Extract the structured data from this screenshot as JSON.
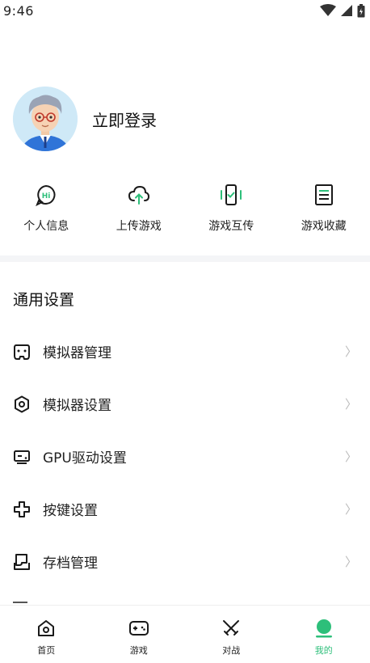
{
  "status_bar": {
    "time": "9:46"
  },
  "profile": {
    "login_label": "立即登录"
  },
  "quick_actions": [
    {
      "label": "个人信息",
      "icon": "chat-hi-icon"
    },
    {
      "label": "上传游戏",
      "icon": "cloud-upload-icon"
    },
    {
      "label": "游戏互传",
      "icon": "phone-transfer-icon"
    },
    {
      "label": "游戏收藏",
      "icon": "list-document-icon"
    }
  ],
  "general_settings": {
    "title": "通用设置",
    "items": [
      {
        "label": "模拟器管理",
        "icon": "gamepad-icon"
      },
      {
        "label": "模拟器设置",
        "icon": "gear-icon"
      },
      {
        "label": "GPU驱动设置",
        "icon": "gpu-icon"
      },
      {
        "label": "按键设置",
        "icon": "dpad-icon"
      },
      {
        "label": "存档管理",
        "icon": "save-tray-icon"
      }
    ],
    "chevron": "〉"
  },
  "tab_bar": {
    "tabs": [
      {
        "label": "首页",
        "icon": "home-icon",
        "active": false
      },
      {
        "label": "游戏",
        "icon": "game-controller-icon",
        "active": false
      },
      {
        "label": "对战",
        "icon": "crossed-swords-icon",
        "active": false
      },
      {
        "label": "我的",
        "icon": "profile-icon",
        "active": true
      }
    ]
  },
  "colors": {
    "accent": "#2dbf7a",
    "icon_dark": "#1a1a1a",
    "divider": "#f4f5f7"
  }
}
